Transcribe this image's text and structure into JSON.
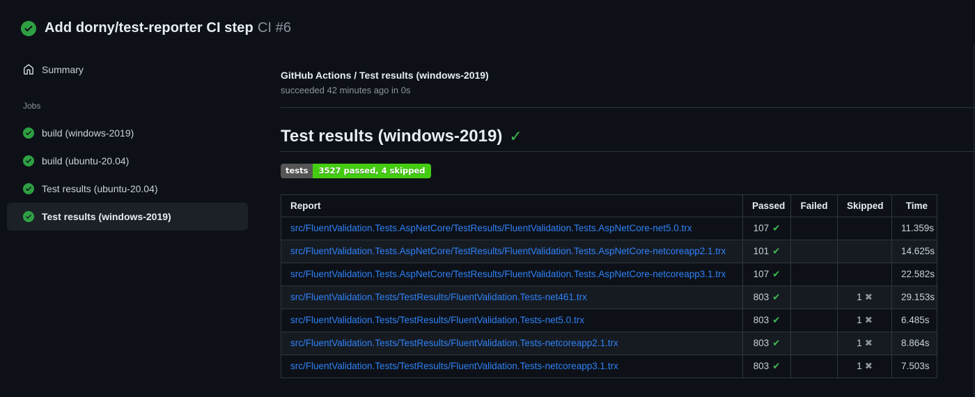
{
  "header": {
    "title": "Add dorny/test-reporter CI step",
    "run_number": "CI #6"
  },
  "sidebar": {
    "summary_label": "Summary",
    "jobs_label": "Jobs",
    "jobs": [
      {
        "label": "build (windows-2019)",
        "status": "success",
        "selected": false
      },
      {
        "label": "build (ubuntu-20.04)",
        "status": "success",
        "selected": false
      },
      {
        "label": "Test results (ubuntu-20.04)",
        "status": "success",
        "selected": false
      },
      {
        "label": "Test results (windows-2019)",
        "status": "success",
        "selected": true
      }
    ]
  },
  "main": {
    "run_title": "GitHub Actions / Test results (windows-2019)",
    "run_status": "succeeded 42 minutes ago in 0s",
    "section_title": "Test results (windows-2019)",
    "badge": {
      "label": "tests",
      "value": "3527 passed, 4 skipped",
      "label_bg": "#555555",
      "value_bg": "#44cc11"
    },
    "table": {
      "headers": [
        "Report",
        "Passed",
        "Failed",
        "Skipped",
        "Time"
      ],
      "rows": [
        {
          "report": "src/FluentValidation.Tests.AspNetCore/TestResults/FluentValidation.Tests.AspNetCore-net5.0.trx",
          "passed": "107",
          "failed": "",
          "skipped": "",
          "time": "11.359s"
        },
        {
          "report": "src/FluentValidation.Tests.AspNetCore/TestResults/FluentValidation.Tests.AspNetCore-netcoreapp2.1.trx",
          "passed": "101",
          "failed": "",
          "skipped": "",
          "time": "14.625s"
        },
        {
          "report": "src/FluentValidation.Tests.AspNetCore/TestResults/FluentValidation.Tests.AspNetCore-netcoreapp3.1.trx",
          "passed": "107",
          "failed": "",
          "skipped": "",
          "time": "22.582s"
        },
        {
          "report": "src/FluentValidation.Tests/TestResults/FluentValidation.Tests-net461.trx",
          "passed": "803",
          "failed": "",
          "skipped": "1",
          "time": "29.153s"
        },
        {
          "report": "src/FluentValidation.Tests/TestResults/FluentValidation.Tests-net5.0.trx",
          "passed": "803",
          "failed": "",
          "skipped": "1",
          "time": "6.485s"
        },
        {
          "report": "src/FluentValidation.Tests/TestResults/FluentValidation.Tests-netcoreapp2.1.trx",
          "passed": "803",
          "failed": "",
          "skipped": "1",
          "time": "8.864s"
        },
        {
          "report": "src/FluentValidation.Tests/TestResults/FluentValidation.Tests-netcoreapp3.1.trx",
          "passed": "803",
          "failed": "",
          "skipped": "1",
          "time": "7.503s"
        }
      ]
    }
  },
  "icons": {
    "success_check": "✔",
    "skipped_cross": "✖",
    "heading_check": "✓"
  },
  "colors": {
    "background": "#0d1117",
    "accent_green": "#3fb950",
    "icon_green": "#2ea043",
    "link_blue": "#2f81f7",
    "muted_text": "#8b949e",
    "border": "#30363d"
  }
}
